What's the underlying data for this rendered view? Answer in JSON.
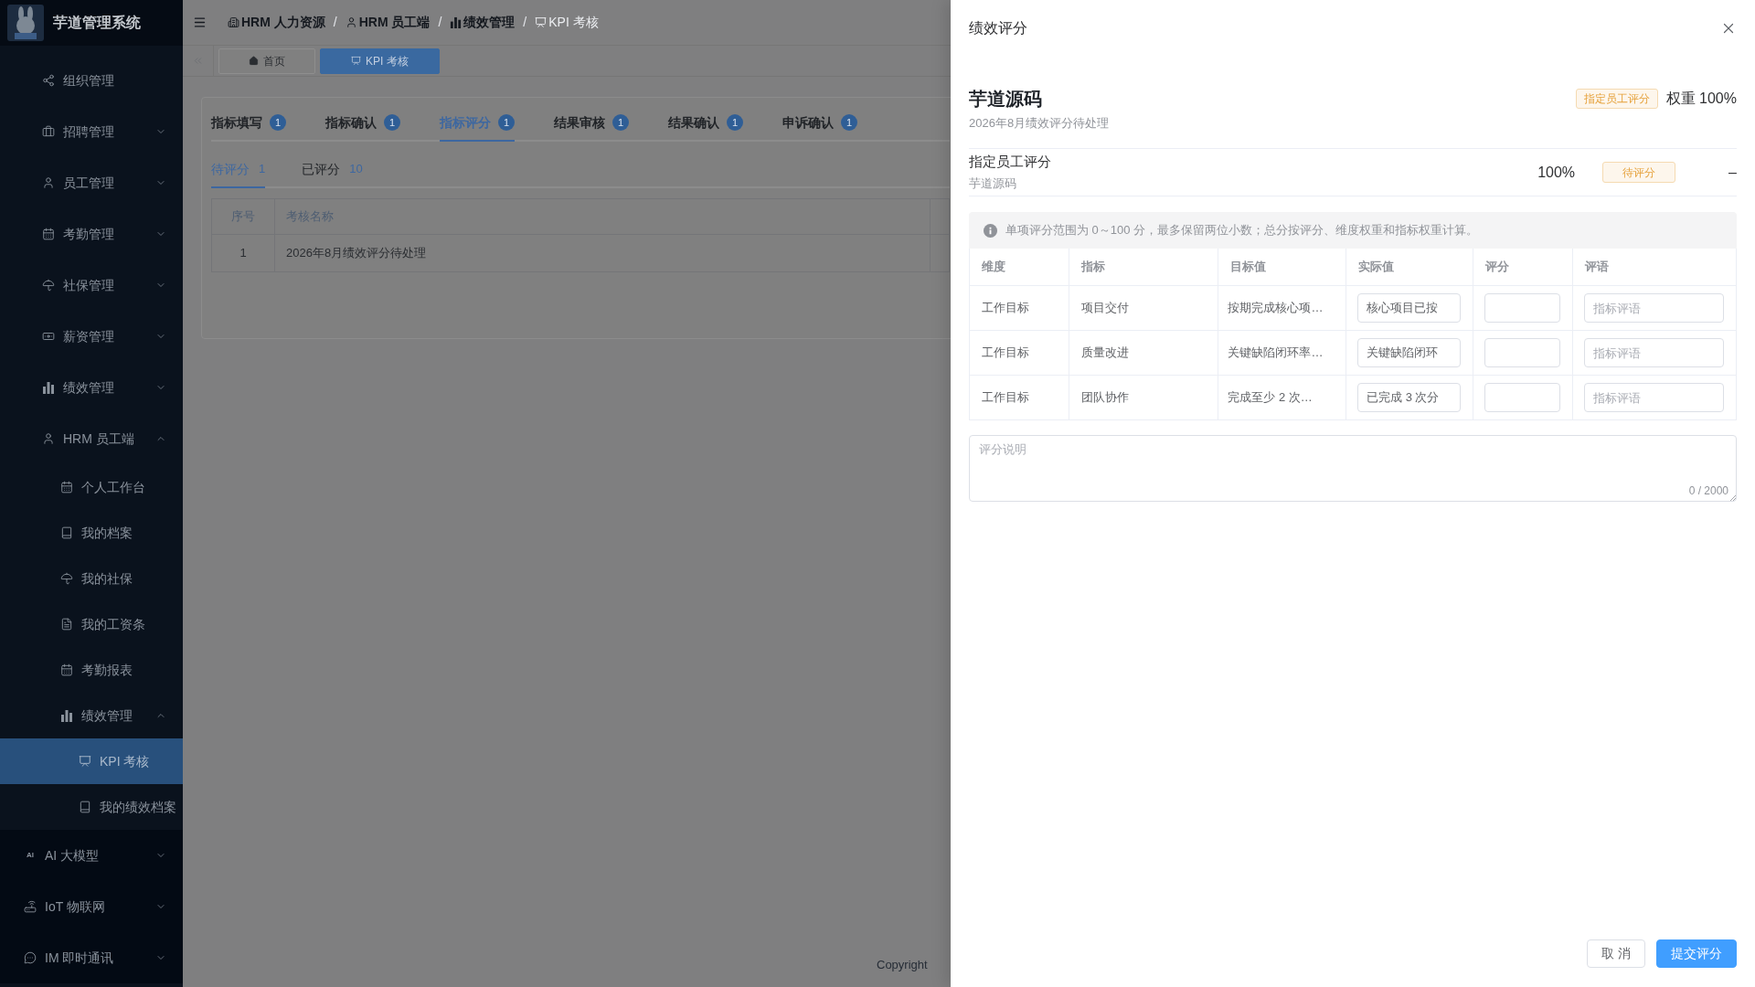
{
  "sidebar": {
    "brand": {
      "title": "芋道管理系统"
    },
    "items": [
      {
        "children": [
          {
            "label": "组织管理",
            "kind": "item",
            "selected": false
          },
          {
            "label": "招聘管理",
            "kind": "submenu",
            "expanded": false
          },
          {
            "label": "员工管理",
            "kind": "submenu",
            "expanded": false
          },
          {
            "label": "考勤管理",
            "kind": "submenu",
            "expanded": false
          },
          {
            "label": "社保管理",
            "kind": "submenu",
            "expanded": false
          },
          {
            "label": "薪资管理",
            "kind": "submenu",
            "expanded": false
          },
          {
            "label": "绩效管理",
            "kind": "submenu",
            "expanded": false
          },
          {
            "label": "HRM 员工端",
            "kind": "submenu",
            "expanded": true,
            "children": [
              {
                "label": "个人工作台",
                "kind": "item",
                "selected": false
              },
              {
                "label": "我的档案",
                "kind": "item",
                "selected": false
              },
              {
                "label": "我的社保",
                "kind": "item",
                "selected": false
              },
              {
                "label": "我的工资条",
                "kind": "item",
                "selected": false
              },
              {
                "label": "考勤报表",
                "kind": "item",
                "selected": false
              },
              {
                "label": "绩效管理",
                "kind": "submenu",
                "expanded": true,
                "children": [
                  {
                    "label": "KPI 考核",
                    "kind": "item",
                    "selected": true
                  },
                  {
                    "label": "我的绩效档案",
                    "kind": "item",
                    "selected": false
                  }
                ]
              }
            ]
          }
        ]
      },
      {
        "label": "AI 大模型",
        "kind": "submenu",
        "expanded": false,
        "icon_text": "AI"
      },
      {
        "label": "IoT 物联网",
        "kind": "submenu",
        "expanded": false
      },
      {
        "label": "IM 即时通讯",
        "kind": "submenu",
        "expanded": false
      }
    ]
  },
  "navbar": {
    "breadcrumb": {
      "separator": "/",
      "items": [
        {
          "label": "HRM 人力资源",
          "current": false
        },
        {
          "label": "HRM 员工端",
          "current": false
        },
        {
          "label": "绩效管理",
          "current": false
        },
        {
          "label": "KPI 考核",
          "current": true
        }
      ]
    }
  },
  "tags_view": {
    "tags": [
      {
        "label": "首页",
        "selected": false
      },
      {
        "label": "KPI 考核",
        "selected": true
      }
    ]
  },
  "content": {
    "tabs": [
      {
        "label": "指标填写",
        "badge": "1",
        "selected": false
      },
      {
        "label": "指标确认",
        "badge": "1",
        "selected": false
      },
      {
        "label": "指标评分",
        "badge": "1",
        "selected": true
      },
      {
        "label": "结果审核",
        "badge": "1",
        "selected": false
      },
      {
        "label": "结果确认",
        "badge": "1",
        "selected": false
      },
      {
        "label": "申诉确认",
        "badge": "1",
        "selected": false
      }
    ],
    "sub_tabs": [
      {
        "label": "待评分",
        "count": "1",
        "selected": true
      },
      {
        "label": "已评分",
        "count": "10",
        "selected": false
      }
    ],
    "table": {
      "columns": [
        "序号",
        "考核名称"
      ],
      "rows": [
        [
          "1",
          "2026年8月绩效评分待处理"
        ]
      ]
    }
  },
  "footer": {
    "copyright": "Copyright"
  },
  "drawer": {
    "title": "绩效评分",
    "reviewee": {
      "name": "芋道源码",
      "subtitle": "2026年8月绩效评分待处理",
      "tag": "指定员工评分",
      "weight": "权重 100%"
    },
    "scorer": {
      "title": "指定员工评分",
      "name": "芋道源码",
      "weight": "100%",
      "status": "待评分",
      "score": "–"
    },
    "notice": "单项评分范围为 0～100 分，最多保留两位小数；总分按评分、维度权重和指标权重计算。",
    "table": {
      "columns": [
        "维度",
        "指标",
        "目标值",
        "实际值",
        "评分",
        "评语"
      ],
      "rows": [
        {
          "dimension": "工作目标",
          "indicator": "项目交付",
          "target": "按期完成核心项…",
          "actual": "核心项目已按",
          "comment_placeholder": "指标评语"
        },
        {
          "dimension": "工作目标",
          "indicator": "质量改进",
          "target": "关键缺陷闭环率…",
          "actual": "关键缺陷闭环",
          "comment_placeholder": "指标评语"
        },
        {
          "dimension": "工作目标",
          "indicator": "团队协作",
          "target": "完成至少 2 次…",
          "actual": "已完成 3 次分",
          "comment_placeholder": "指标评语"
        }
      ]
    },
    "remark": {
      "placeholder": "评分说明",
      "counter": "0 / 2000"
    },
    "buttons": [
      {
        "label": "取 消",
        "kind": "secondary"
      },
      {
        "label": "提交评分",
        "kind": "primary"
      }
    ]
  }
}
